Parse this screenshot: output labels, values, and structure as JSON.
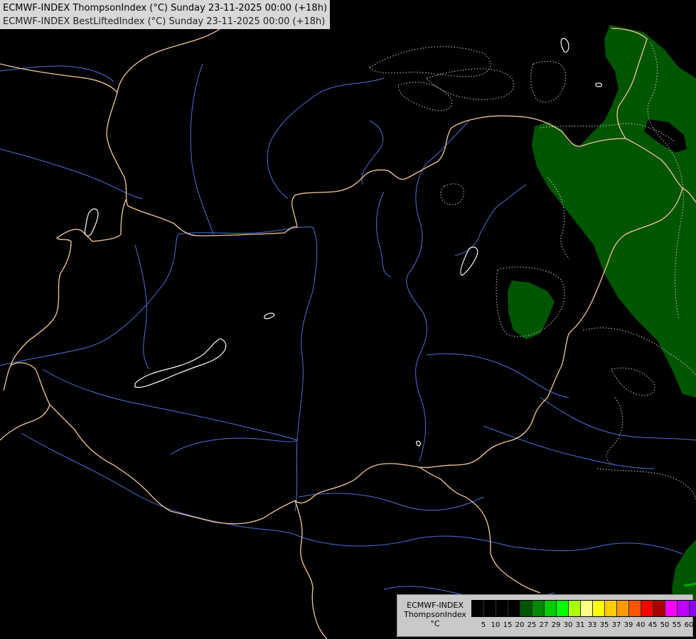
{
  "header": {
    "line1": "ECMWF-INDEX ThompsonIndex (°C) Sunday 23-11-2025 00:00 (+18h)",
    "line2": "ECMWF-INDEX BestLiftedIndex (°C) Sunday 23-11-2025 00:00 (+18h)"
  },
  "legend": {
    "model": "ECMWF-INDEX",
    "parameter": "ThompsonIndex",
    "unit": "°C",
    "colors": [
      "#000000",
      "#000000",
      "#000000",
      "#000000",
      "#005500",
      "#008800",
      "#00cc00",
      "#00ff00",
      "#aaff00",
      "#ffff88",
      "#ffff00",
      "#ffcc00",
      "#ff9900",
      "#ff5500",
      "#ff0000",
      "#aa0000",
      "#ff00ff",
      "#bb00ff",
      "#8800ff",
      "#4400ff",
      "#0000ff"
    ],
    "ticks": [
      "5",
      "10",
      "15",
      "20",
      "25",
      "27",
      "29",
      "30",
      "31",
      "33",
      "35",
      "37",
      "39",
      "40",
      "45",
      "50",
      "55",
      "60"
    ]
  },
  "map_style": {
    "background": "#000000",
    "border_color": "#f3c99a",
    "river_color": "#5070d8",
    "lake_color": "#ffffff",
    "thompson_fill": "#005500",
    "lifted_contour_color": "#d0d0d0"
  }
}
